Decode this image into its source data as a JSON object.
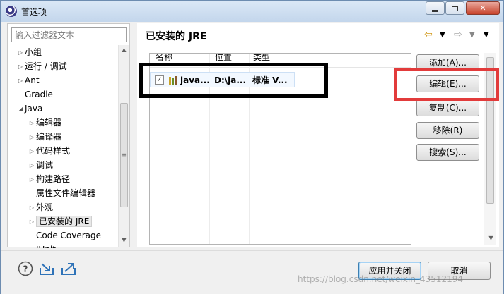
{
  "window": {
    "title": "首选项"
  },
  "filter": {
    "placeholder": "输入过滤器文本"
  },
  "tree": [
    {
      "label": "小组",
      "expand": "closed",
      "indent": 0
    },
    {
      "label": "运行 / 调试",
      "expand": "closed",
      "indent": 0
    },
    {
      "label": "Ant",
      "expand": "closed",
      "indent": 0
    },
    {
      "label": "Gradle",
      "expand": "none",
      "indent": 0
    },
    {
      "label": "Java",
      "expand": "open",
      "indent": 0
    },
    {
      "label": "编辑器",
      "expand": "closed",
      "indent": 1
    },
    {
      "label": "编译器",
      "expand": "closed",
      "indent": 1
    },
    {
      "label": "代码样式",
      "expand": "closed",
      "indent": 1
    },
    {
      "label": "调试",
      "expand": "closed",
      "indent": 1
    },
    {
      "label": "构建路径",
      "expand": "closed",
      "indent": 1
    },
    {
      "label": "属性文件编辑器",
      "expand": "none",
      "indent": 1
    },
    {
      "label": "外观",
      "expand": "closed",
      "indent": 1
    },
    {
      "label": "已安装的 JRE",
      "expand": "closed",
      "indent": 1,
      "selected": true
    },
    {
      "label": "Code Coverage",
      "expand": "none",
      "indent": 1
    },
    {
      "label": "JUnit",
      "expand": "none",
      "indent": 1
    }
  ],
  "page": {
    "heading": "已安装的 JRE"
  },
  "table": {
    "columns": [
      "名称",
      "位置",
      "类型"
    ],
    "rows": [
      {
        "checked": true,
        "name": "java...",
        "location": "D:\\ja...",
        "type": "标准 V..."
      }
    ]
  },
  "buttons": {
    "add": "添加(A)...",
    "edit": "编辑(E)...",
    "copy": "复制(C)...",
    "remove": "移除(R)",
    "search": "搜索(S)..."
  },
  "footer": {
    "apply_close": "应用并关闭",
    "cancel": "取消"
  },
  "watermark": "https://blog.csdn.net/weixin_43512194",
  "icons": {
    "help": "help-icon",
    "import": "import-icon",
    "export": "export-icon"
  },
  "colors": {
    "highlight_red": "#e23b3b",
    "highlight_black": "#000000"
  }
}
